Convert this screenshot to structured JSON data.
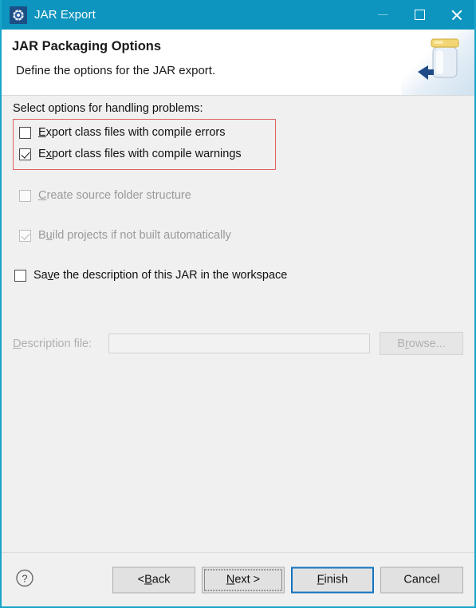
{
  "window": {
    "title": "JAR Export",
    "icon": "gear-icon",
    "accent_color": "#0d95bf",
    "body_bg": "#f0f0f0",
    "controls": {
      "minimize": "—",
      "maximize": "□",
      "close": "✕"
    }
  },
  "header": {
    "title": "JAR Packaging Options",
    "subtitle": "Define the options for the JAR export.",
    "art": "jar-export-banner-icon"
  },
  "main": {
    "section_label": "Select options for handling problems:",
    "highlight_color": "#e06262",
    "options": [
      {
        "id": "export-with-errors",
        "label_pre": "",
        "mnemonic": "E",
        "label_post": "xport class files with compile errors",
        "checked": false,
        "enabled": true
      },
      {
        "id": "export-with-warnings",
        "label_pre": "E",
        "mnemonic": "x",
        "label_post": "port class files with compile warnings",
        "checked": true,
        "enabled": true
      },
      {
        "id": "create-source-folder-structure",
        "label_pre": "",
        "mnemonic": "C",
        "label_post": "reate source folder structure",
        "checked": false,
        "enabled": false
      },
      {
        "id": "build-projects-if-not-built",
        "label_pre": "B",
        "mnemonic": "u",
        "label_post": "ild projects if not built automatically",
        "checked": true,
        "enabled": false
      },
      {
        "id": "save-description-in-workspace",
        "label_pre": "Sa",
        "mnemonic": "v",
        "label_post": "e the description of this JAR in the workspace",
        "checked": false,
        "enabled": true
      }
    ],
    "description": {
      "label_pre": "",
      "label_mnemonic": "D",
      "label_post": "escription file:",
      "value": "",
      "placeholder": "",
      "enabled": false
    },
    "browse": {
      "label_pre": "B",
      "mnemonic": "r",
      "label_post": "owse...",
      "enabled": false
    }
  },
  "footer": {
    "help": "help-icon",
    "buttons": [
      {
        "id": "back",
        "label_pre": "< ",
        "mnemonic": "B",
        "label_post": "ack",
        "state": "normal"
      },
      {
        "id": "next",
        "label_pre": "",
        "mnemonic": "N",
        "label_post": "ext >",
        "state": "focused"
      },
      {
        "id": "finish",
        "label_pre": "",
        "mnemonic": "F",
        "label_post": "inish",
        "state": "default"
      },
      {
        "id": "cancel",
        "label_pre": "Cancel",
        "mnemonic": "",
        "label_post": "",
        "state": "normal"
      }
    ]
  }
}
